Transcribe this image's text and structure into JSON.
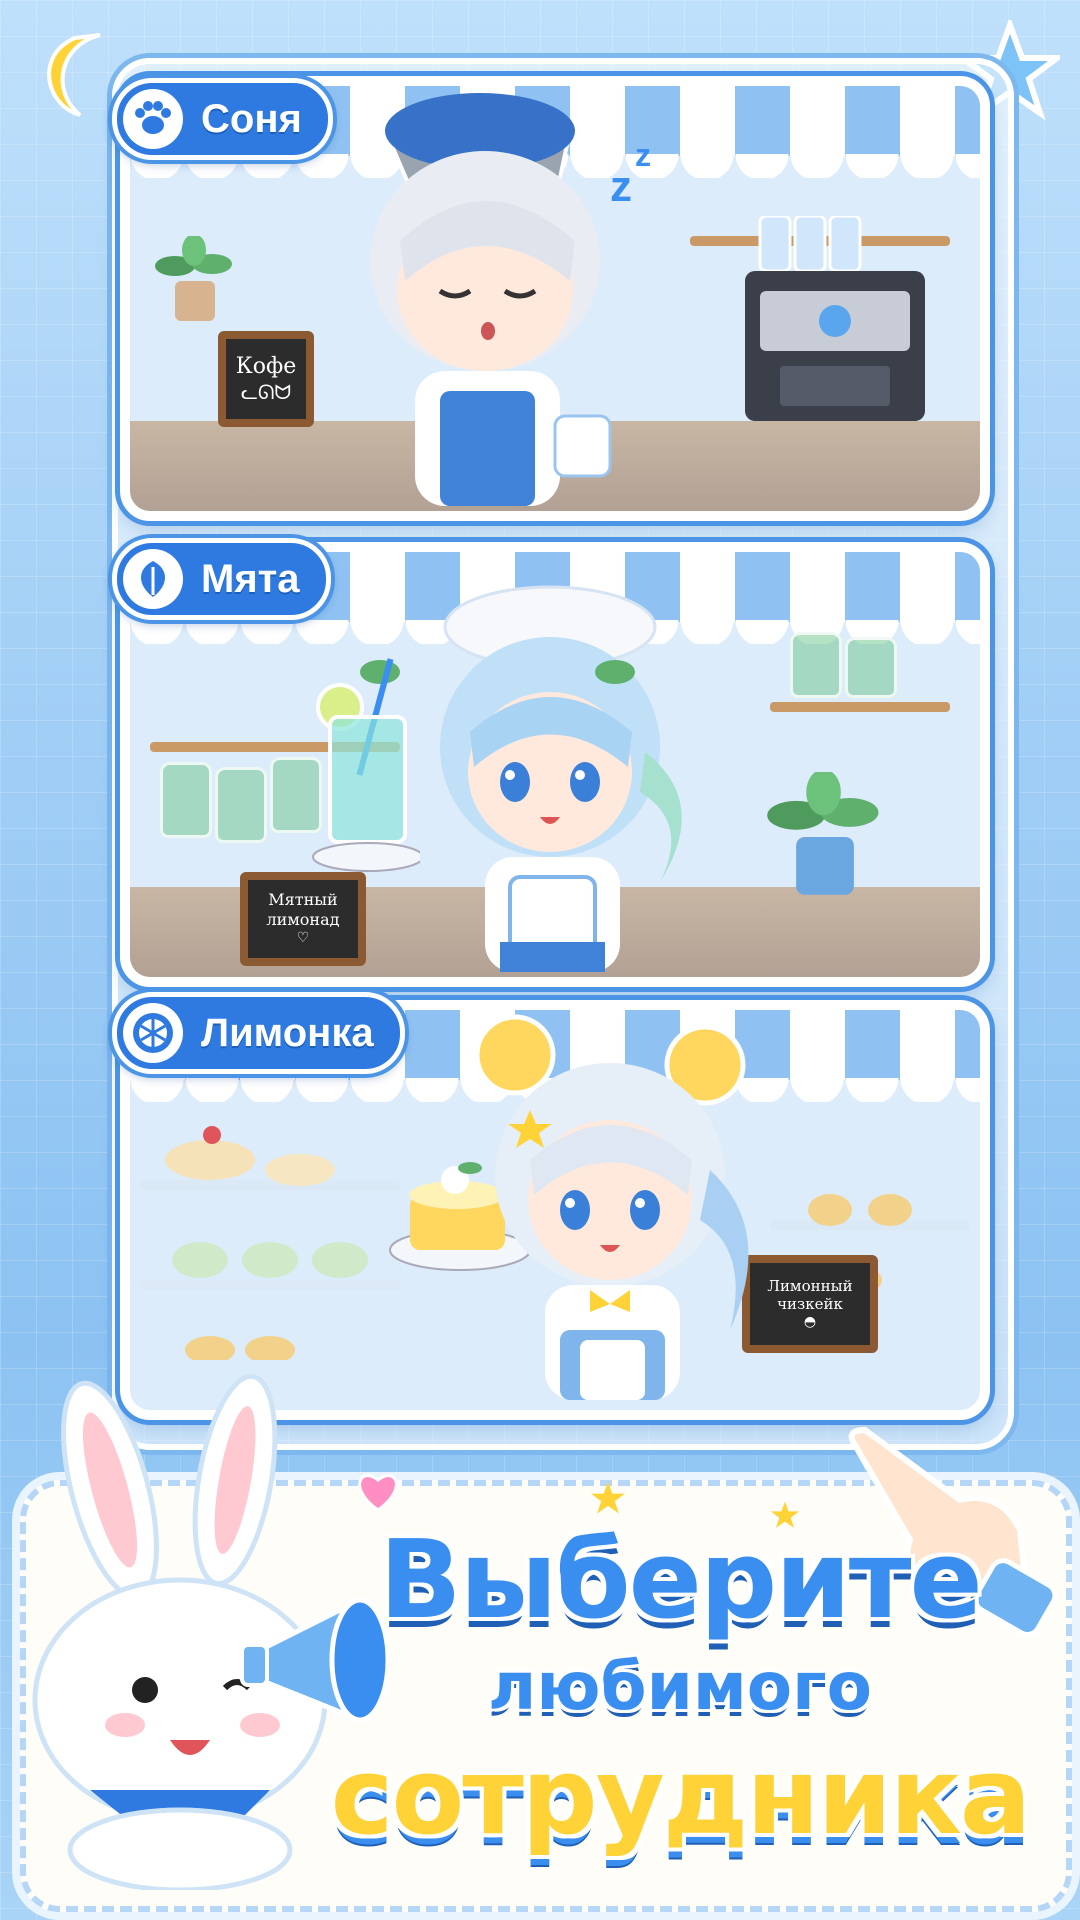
{
  "characters": [
    {
      "name": "Соня",
      "icon": "paw-icon",
      "sign_lines": [
        "Кофе"
      ]
    },
    {
      "name": "Мята",
      "icon": "leaf-icon",
      "sign_lines": [
        "Мятный",
        "лимонад"
      ]
    },
    {
      "name": "Лимонка",
      "icon": "lemon-slice-icon",
      "sign_lines": [
        "Лимонный",
        "чизкейк"
      ]
    }
  ],
  "headline": {
    "line1": "Выберите",
    "line2": "любимого",
    "line3": "сотрудника"
  },
  "colors": {
    "primary_blue": "#2f7ae0",
    "accent_yellow": "#ffd338",
    "background": "#9fcdf5"
  }
}
